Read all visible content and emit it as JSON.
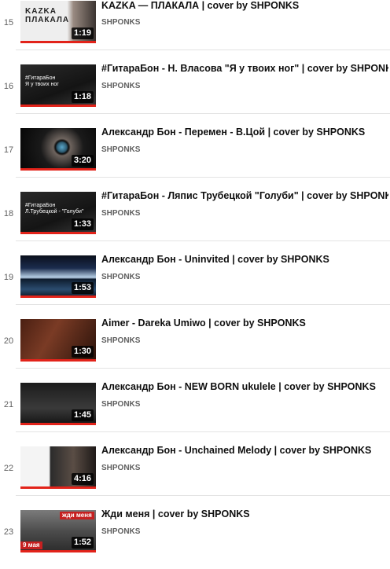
{
  "playlist": {
    "items": [
      {
        "index": "15",
        "title": "KAZKA — ПЛАКАЛА | cover by SHPONKS",
        "channel": "SHPONKS",
        "duration": "1:19",
        "thumb_text": "KAZKA\nПЛАКАЛА",
        "thumb_style": "kazka"
      },
      {
        "index": "16",
        "title": "#ГитараБон - Н. Власова \"Я у твоих ног\" | cover by SHPONKS",
        "channel": "SHPONKS",
        "duration": "1:18",
        "thumb_text": "#ГитараБон\nЯ у твоих ног",
        "thumb_style": "dark"
      },
      {
        "index": "17",
        "title": "Александр Бон - Перемен - В.Цой | cover by SHPONKS",
        "channel": "SHPONKS",
        "duration": "3:20",
        "thumb_text": "",
        "thumb_style": "eye"
      },
      {
        "index": "18",
        "title": "#ГитараБон - Ляпис Трубецкой \"Голуби\" | cover by SHPONKS",
        "channel": "SHPONKS",
        "duration": "1:33",
        "thumb_text": "#ГитараБон\nЛ.Трубецкой - \"Голуби\"",
        "thumb_style": "dark"
      },
      {
        "index": "19",
        "title": "Александр Бон - Uninvited | cover by SHPONKS",
        "channel": "SHPONKS",
        "duration": "1:53",
        "thumb_text": "",
        "thumb_style": "lake"
      },
      {
        "index": "20",
        "title": "Aimer - Dareka Umiwo | cover by SHPONKS",
        "channel": "SHPONKS",
        "duration": "1:30",
        "thumb_text": "",
        "thumb_style": "brown"
      },
      {
        "index": "21",
        "title": "Александр Бон - NEW BORN ukulele | cover by SHPONKS",
        "channel": "SHPONKS",
        "duration": "1:45",
        "thumb_text": "",
        "thumb_style": "bw"
      },
      {
        "index": "22",
        "title": "Александр Бон - Unchained Melody | cover by SHPONKS",
        "channel": "SHPONKS",
        "duration": "4:16",
        "thumb_text": "",
        "thumb_style": "collage"
      },
      {
        "index": "23",
        "title": "Жди меня | cover by SHPONKS",
        "channel": "SHPONKS",
        "duration": "1:52",
        "thumb_text": "жди меня",
        "thumb_badge": "9 мая",
        "thumb_style": "war"
      }
    ]
  },
  "colors": {
    "progress": "#e2231a",
    "text": "#0f0f0f",
    "meta": "#606060",
    "separator": "#e3e3e3"
  }
}
